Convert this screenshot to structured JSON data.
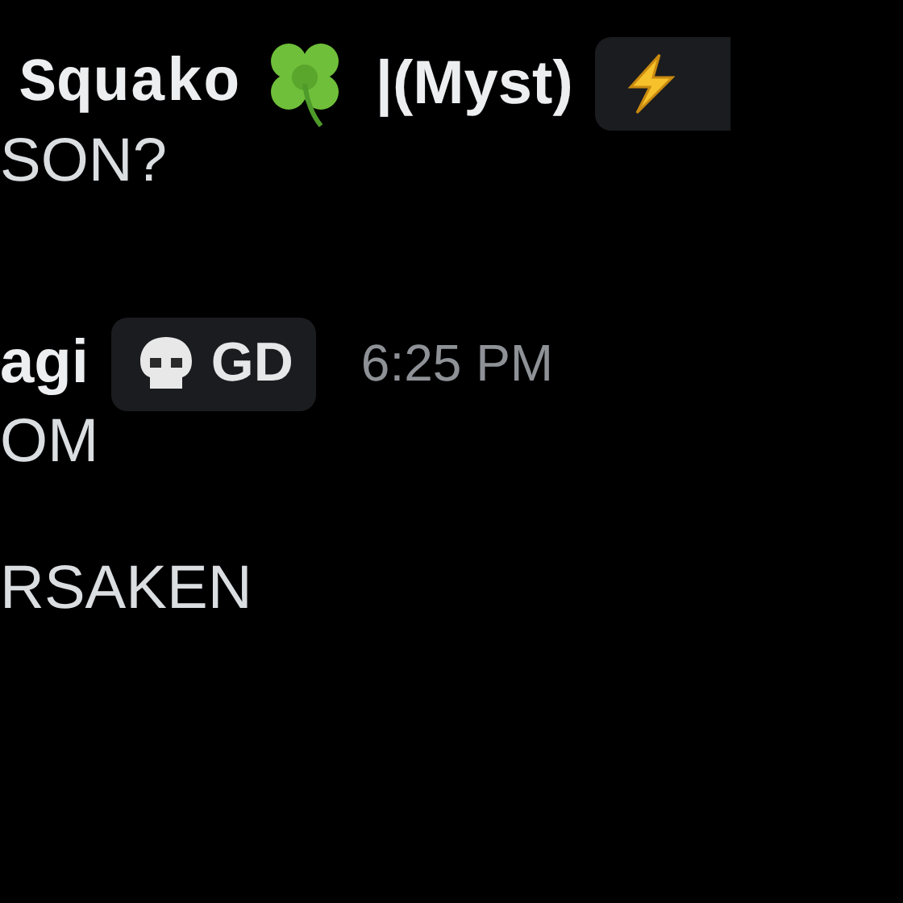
{
  "messages": [
    {
      "author": {
        "name": "Squako",
        "suffix": "|(Myst)"
      },
      "badge": {
        "kind": "lightning"
      },
      "lines": [
        "SON?"
      ]
    },
    {
      "author": {
        "name": "agi"
      },
      "badge": {
        "kind": "skull",
        "label": "GD"
      },
      "time": "6:25 PM",
      "lines": [
        "OM",
        "RSAKEN"
      ]
    }
  ]
}
